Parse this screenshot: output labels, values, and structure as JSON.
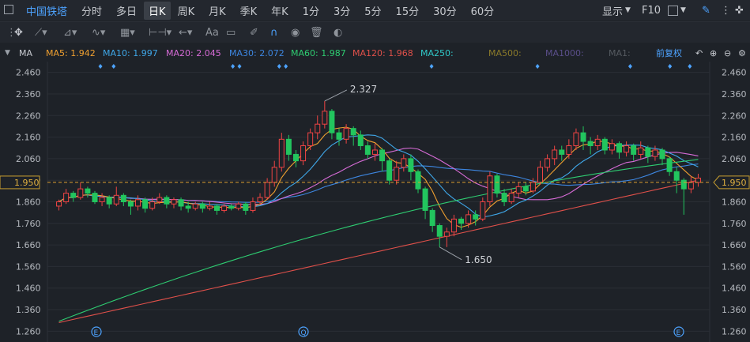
{
  "topbar": {
    "stock": "中国铁塔",
    "periods": [
      "分时",
      "多日",
      "日K",
      "周K",
      "月K",
      "季K",
      "年K",
      "1分",
      "3分",
      "5分",
      "15分",
      "30分",
      "60分"
    ],
    "active_period": "日K",
    "display_label": "显示",
    "f10_label": "F10"
  },
  "toolbar": {
    "font_label": "Aa"
  },
  "ma_bar": {
    "label": "MA",
    "items": [
      {
        "text": "MA5: 1.942",
        "color": "#f0a030"
      },
      {
        "text": "MA10: 1.997",
        "color": "#3fa7e8"
      },
      {
        "text": "MA20: 2.045",
        "color": "#d66bd6"
      },
      {
        "text": "MA30: 2.072",
        "color": "#3d86e0"
      },
      {
        "text": "MA60: 1.987",
        "color": "#2ecc71"
      },
      {
        "text": "MA120: 1.968",
        "color": "#e0504a"
      },
      {
        "text": "MA250:",
        "color": "#30c8c8"
      },
      {
        "text": "MA500:",
        "color": "#8a7a2a"
      },
      {
        "text": "MA1000:",
        "color": "#5a4e8a"
      },
      {
        "text": "MA1:",
        "color": "#555a60"
      }
    ],
    "adjust_label": "前复权"
  },
  "chart_data": {
    "type": "candlestick",
    "y_ticks": [
      "2.460",
      "2.360",
      "2.260",
      "2.160",
      "2.060",
      "1.960",
      "1.860",
      "1.760",
      "1.660",
      "1.560",
      "1.460",
      "1.360",
      "1.260"
    ],
    "ylim": [
      1.21,
      2.51
    ],
    "current_price": "1.950",
    "high_annotation": "2.327",
    "low_annotation": "1.650",
    "event_markers": [
      "E",
      "Q",
      "E"
    ],
    "candles": [
      [
        1.84,
        1.86,
        1.82,
        1.87
      ],
      [
        1.86,
        1.9,
        1.85,
        1.92
      ],
      [
        1.9,
        1.88,
        1.86,
        1.91
      ],
      [
        1.88,
        1.92,
        1.87,
        1.95
      ],
      [
        1.92,
        1.9,
        1.88,
        1.93
      ],
      [
        1.9,
        1.86,
        1.85,
        1.91
      ],
      [
        1.86,
        1.88,
        1.84,
        1.9
      ],
      [
        1.88,
        1.85,
        1.83,
        1.89
      ],
      [
        1.85,
        1.89,
        1.84,
        1.93
      ],
      [
        1.89,
        1.86,
        1.84,
        1.9
      ],
      [
        1.86,
        1.84,
        1.8,
        1.87
      ],
      [
        1.84,
        1.87,
        1.82,
        1.89
      ],
      [
        1.87,
        1.83,
        1.81,
        1.88
      ],
      [
        1.83,
        1.86,
        1.82,
        1.88
      ],
      [
        1.86,
        1.88,
        1.85,
        1.9
      ],
      [
        1.88,
        1.85,
        1.83,
        1.89
      ],
      [
        1.85,
        1.87,
        1.83,
        1.88
      ],
      [
        1.87,
        1.84,
        1.82,
        1.88
      ],
      [
        1.84,
        1.83,
        1.81,
        1.86
      ],
      [
        1.83,
        1.85,
        1.82,
        1.86
      ],
      [
        1.85,
        1.83,
        1.81,
        1.86
      ],
      [
        1.83,
        1.84,
        1.82,
        1.86
      ],
      [
        1.84,
        1.82,
        1.8,
        1.85
      ],
      [
        1.82,
        1.84,
        1.81,
        1.85
      ],
      [
        1.84,
        1.83,
        1.82,
        1.85
      ],
      [
        1.83,
        1.85,
        1.82,
        1.86
      ],
      [
        1.85,
        1.82,
        1.8,
        1.86
      ],
      [
        1.82,
        1.86,
        1.81,
        1.88
      ],
      [
        1.86,
        1.88,
        1.85,
        1.9
      ],
      [
        1.88,
        1.95,
        1.87,
        1.97
      ],
      [
        1.95,
        2.02,
        1.93,
        2.05
      ],
      [
        2.02,
        2.15,
        2.0,
        2.18
      ],
      [
        2.15,
        2.08,
        2.05,
        2.17
      ],
      [
        2.08,
        2.05,
        2.02,
        2.1
      ],
      [
        2.05,
        2.12,
        2.03,
        2.14
      ],
      [
        2.12,
        2.18,
        2.1,
        2.2
      ],
      [
        2.18,
        2.22,
        2.15,
        2.26
      ],
      [
        2.22,
        2.28,
        2.2,
        2.327
      ],
      [
        2.28,
        2.18,
        2.15,
        2.29
      ],
      [
        2.18,
        2.15,
        2.12,
        2.2
      ],
      [
        2.15,
        2.2,
        2.13,
        2.22
      ],
      [
        2.2,
        2.17,
        2.12,
        2.21
      ],
      [
        2.17,
        2.12,
        2.1,
        2.19
      ],
      [
        2.12,
        2.08,
        2.06,
        2.14
      ],
      [
        2.08,
        2.1,
        2.05,
        2.13
      ],
      [
        2.1,
        2.05,
        2.0,
        2.11
      ],
      [
        2.05,
        1.96,
        1.94,
        2.06
      ],
      [
        1.96,
        2.02,
        1.94,
        2.05
      ],
      [
        2.02,
        2.06,
        2.0,
        2.08
      ],
      [
        2.06,
        2.0,
        1.96,
        2.08
      ],
      [
        2.0,
        1.92,
        1.9,
        2.01
      ],
      [
        1.92,
        1.82,
        1.78,
        1.93
      ],
      [
        1.82,
        1.75,
        1.72,
        1.83
      ],
      [
        1.75,
        1.7,
        1.65,
        1.76
      ],
      [
        1.7,
        1.72,
        1.65,
        1.74
      ],
      [
        1.72,
        1.78,
        1.7,
        1.8
      ],
      [
        1.78,
        1.76,
        1.73,
        1.79
      ],
      [
        1.76,
        1.8,
        1.74,
        1.82
      ],
      [
        1.8,
        1.78,
        1.75,
        1.82
      ],
      [
        1.78,
        1.86,
        1.77,
        1.88
      ],
      [
        1.86,
        1.98,
        1.84,
        2.0
      ],
      [
        1.98,
        1.9,
        1.88,
        1.99
      ],
      [
        1.9,
        1.86,
        1.84,
        1.92
      ],
      [
        1.86,
        1.9,
        1.85,
        1.92
      ],
      [
        1.9,
        1.93,
        1.88,
        1.95
      ],
      [
        1.93,
        1.91,
        1.89,
        1.95
      ],
      [
        1.91,
        1.95,
        1.9,
        1.97
      ],
      [
        1.95,
        2.02,
        1.94,
        2.05
      ],
      [
        2.02,
        2.06,
        2.0,
        2.08
      ],
      [
        2.06,
        2.1,
        2.03,
        2.12
      ],
      [
        2.1,
        2.08,
        2.05,
        2.12
      ],
      [
        2.08,
        2.12,
        2.06,
        2.15
      ],
      [
        2.12,
        2.18,
        2.1,
        2.2
      ],
      [
        2.18,
        2.14,
        2.1,
        2.21
      ],
      [
        2.14,
        2.12,
        2.08,
        2.16
      ],
      [
        2.12,
        2.15,
        2.1,
        2.17
      ],
      [
        2.15,
        2.1,
        2.08,
        2.16
      ],
      [
        2.1,
        2.13,
        2.08,
        2.15
      ],
      [
        2.13,
        2.09,
        2.06,
        2.14
      ],
      [
        2.09,
        2.12,
        2.07,
        2.14
      ],
      [
        2.12,
        2.08,
        2.05,
        2.13
      ],
      [
        2.08,
        2.11,
        2.06,
        2.14
      ],
      [
        2.11,
        2.07,
        2.04,
        2.12
      ],
      [
        2.07,
        2.1,
        2.05,
        2.12
      ],
      [
        2.1,
        2.06,
        2.03,
        2.11
      ],
      [
        2.06,
        2.0,
        1.98,
        2.07
      ],
      [
        2.0,
        1.96,
        1.9,
        2.02
      ],
      [
        1.96,
        1.92,
        1.8,
        1.97
      ],
      [
        1.92,
        1.95,
        1.9,
        1.98
      ],
      [
        1.95,
        1.97,
        1.93,
        1.99
      ]
    ]
  }
}
